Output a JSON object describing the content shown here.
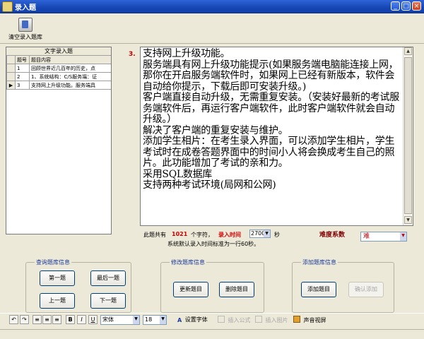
{
  "window": {
    "title": "录入题",
    "min": "_",
    "max": "□",
    "close": "×"
  },
  "toolbar": {
    "clear_label": "清空录入题库"
  },
  "grid": {
    "caption": "文字录入题",
    "headers": [
      "题号",
      "题目内容"
    ],
    "rows": [
      {
        "indicator": "",
        "no": "1",
        "content": "回顾世界近几百年的历史，点"
      },
      {
        "indicator": "",
        "no": "2",
        "content": "1、系统结构：C/S服务端：证"
      },
      {
        "indicator": "▶",
        "no": "3",
        "content": "支持网上升级功能。服务端具"
      }
    ]
  },
  "editor": {
    "number": "3.",
    "content": "支持网上升级功能。\n服务端具有网上升级功能提示(如果服务端电脑能连接上网，那你在开启服务端软件时，如果网上已经有新版本，软件会自动给你提示，下载后即可安装升级。)\n客户端直接自动升级，无需重复安装。（安装好最新的考试服务端软件后，再运行客户端软件，此时客户端软件就会自动升级。）\n解决了客户端的重复安装与维护。\n添加学生相片：在考生录入界面，可以添加学生相片，学生考试时在成卷答题界面中的时间小人将会换成考生自己的照片。此功能增加了考试的亲和力。\n采用SQL数据库\n支持两种考试环境(局网和公网)"
  },
  "info": {
    "prefix": "此题共有",
    "char_count": "1021",
    "chars_label": "个字符，",
    "time_label": "录入时间",
    "time_value": "2700",
    "seconds_label": "秒",
    "note": "系统默认录入时间标准为一行60秒。",
    "difficulty_label": "难度系数",
    "difficulty_value": "难"
  },
  "groups": {
    "query": {
      "label": "查询题库信息",
      "first": "第一题",
      "last": "最后一题",
      "prev": "上一题",
      "next": "下一题"
    },
    "modify": {
      "label": "修改题库信息",
      "update": "更新题目",
      "delete": "删除题目"
    },
    "add": {
      "label": "添加题库信息",
      "add": "添加题目",
      "confirm": "确认添加"
    }
  },
  "format_bar": {
    "font": "宋体",
    "size": "18",
    "bold": "B",
    "italic": "I",
    "underline": "U",
    "set_font": "设置字体",
    "insert_formula": "插入公式",
    "insert_image": "插入图片",
    "audio_video": "声音视屏"
  }
}
